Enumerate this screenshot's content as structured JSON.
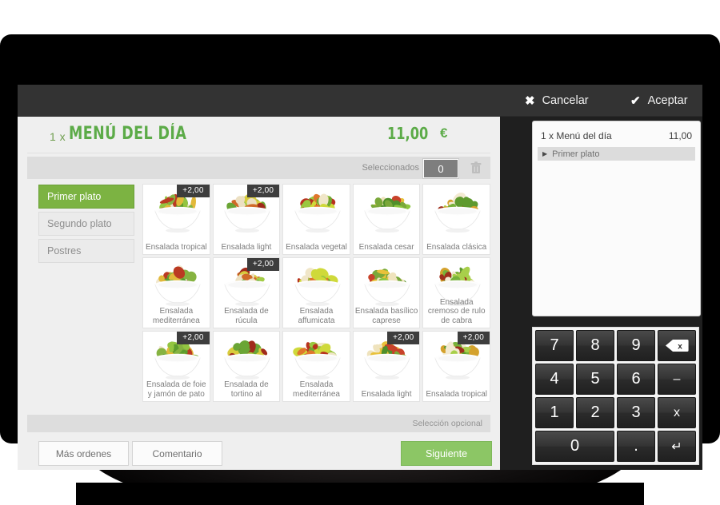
{
  "topbar": {
    "cancel_label": "Cancelar",
    "cancel_icon": "close-icon",
    "accept_label": "Aceptar",
    "accept_icon": "check-icon"
  },
  "order_header": {
    "quantity": "1 x",
    "title": "MENÚ DEL DÍA",
    "price": "11,00",
    "currency": "€"
  },
  "selection_bar": {
    "label": "Seleccionados",
    "count": "0",
    "delete_icon": "trash-icon"
  },
  "tabs": [
    {
      "label": "Primer plato",
      "active": true
    },
    {
      "label": "Segundo plato",
      "active": false
    },
    {
      "label": "Postres",
      "active": false
    }
  ],
  "products": [
    {
      "name": "Ensalada tropical",
      "badge": "+2,00"
    },
    {
      "name": "Ensalada light",
      "badge": "+2,00"
    },
    {
      "name": "Ensalada vegetal",
      "badge": ""
    },
    {
      "name": "Ensalada cesar",
      "badge": ""
    },
    {
      "name": "Ensalada clásica",
      "badge": ""
    },
    {
      "name": "Ensalada mediterránea",
      "badge": ""
    },
    {
      "name": "Ensalada de rúcula",
      "badge": "+2,00"
    },
    {
      "name": "Ensalada affumicata",
      "badge": ""
    },
    {
      "name": "Ensalada basílico caprese",
      "badge": ""
    },
    {
      "name": "Ensalada cremoso de rulo de cabra",
      "badge": ""
    },
    {
      "name": "Ensalada de foie y jamón de pato",
      "badge": "+2,00"
    },
    {
      "name": "Ensalada de tortino al",
      "badge": ""
    },
    {
      "name": "Ensalada mediterránea",
      "badge": ""
    },
    {
      "name": "Ensalada light",
      "badge": "+2,00"
    },
    {
      "name": "Ensalada tropical",
      "badge": "+2,00"
    }
  ],
  "optional_strip": {
    "label": "Selección opcional"
  },
  "footer": {
    "more_orders_label": "Más ordenes",
    "comment_label": "Comentario",
    "next_label": "Siguiente"
  },
  "ticket": {
    "line_label": "1 x Menú del día",
    "line_price": "11,00",
    "sub_label": "Primer plato",
    "sub_caret": "▶"
  },
  "keypad": {
    "rows": [
      [
        {
          "label": "7",
          "name": "key-7"
        },
        {
          "label": "8",
          "name": "key-8"
        },
        {
          "label": "9",
          "name": "key-9"
        },
        {
          "label": "",
          "name": "key-backspace"
        }
      ],
      [
        {
          "label": "4",
          "name": "key-4"
        },
        {
          "label": "5",
          "name": "key-5"
        },
        {
          "label": "6",
          "name": "key-6"
        },
        {
          "label": "–",
          "name": "key-minus"
        }
      ],
      [
        {
          "label": "1",
          "name": "key-1"
        },
        {
          "label": "2",
          "name": "key-2"
        },
        {
          "label": "3",
          "name": "key-3"
        },
        {
          "label": "x",
          "name": "key-multiply"
        }
      ],
      [
        {
          "label": "0",
          "name": "key-0"
        },
        {
          "label": ".",
          "name": "key-decimal"
        },
        {
          "label": "↵",
          "name": "key-enter"
        }
      ]
    ]
  },
  "colors": {
    "brand_green": "#5cab48",
    "tab_green": "#7cb342",
    "button_green": "#8cc665",
    "topbar_dark": "#333333",
    "panel_grey": "#efefef"
  }
}
